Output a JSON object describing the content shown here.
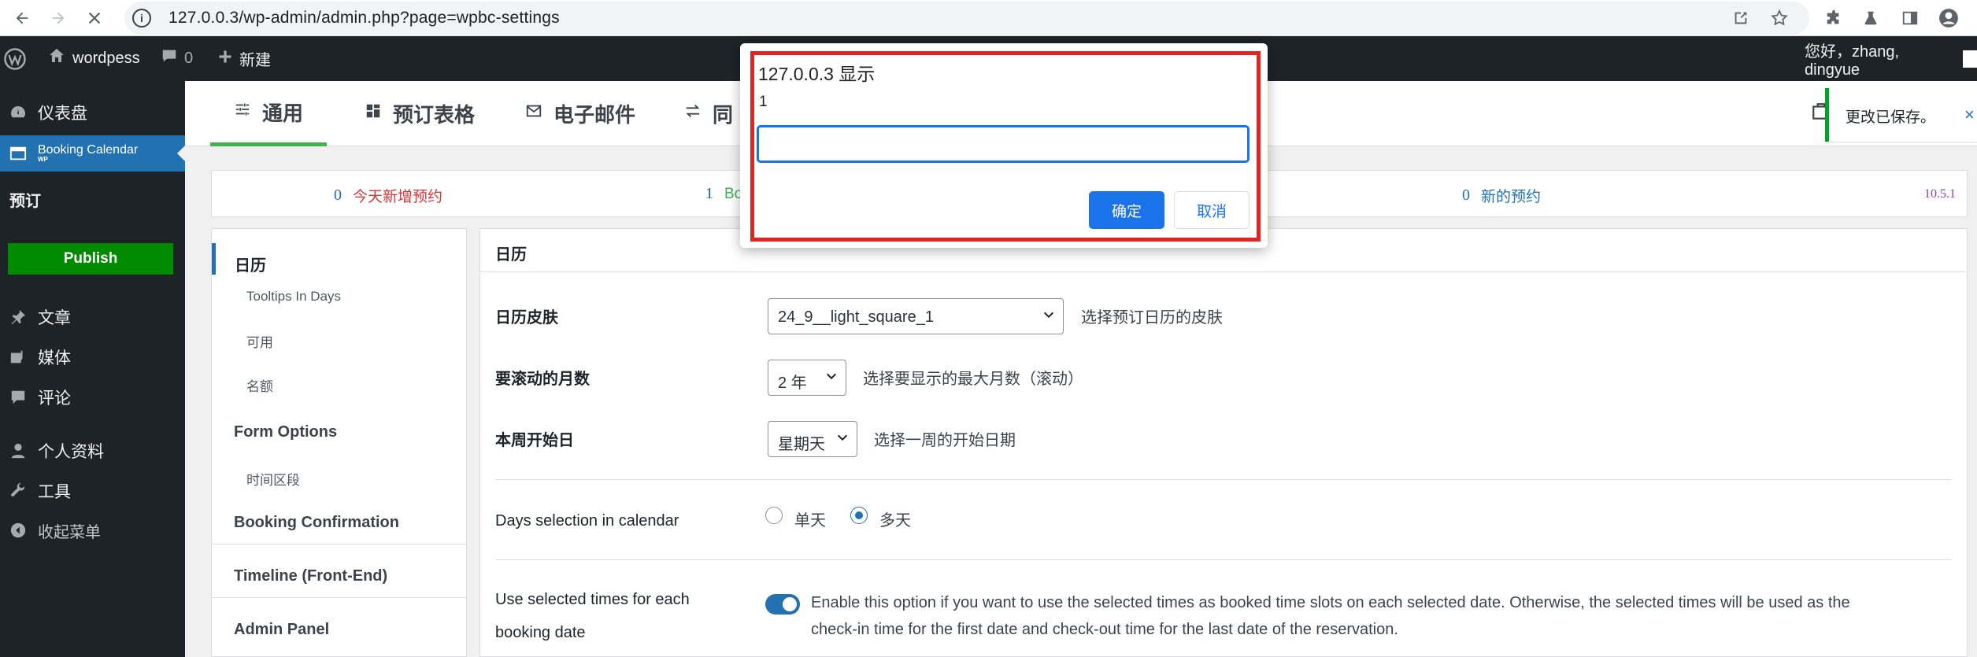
{
  "browser": {
    "url": "127.0.0.3/wp-admin/admin.php?page=wpbc-settings",
    "back_icon": "back-arrow-icon",
    "forward_icon": "forward-arrow-icon",
    "loading_icon": "stop-loading-icon"
  },
  "adminbar": {
    "site_name": "wordpess",
    "comments_count": "0",
    "new_label": "新建",
    "greeting": "您好，zhang, dingyue"
  },
  "sidebar": {
    "items": [
      {
        "label": "仪表盘",
        "icon": "dashboard-icon"
      },
      {
        "label": "Booking Calendar",
        "sub": "WP",
        "icon": "booking-calendar-icon"
      },
      {
        "label": "预订"
      },
      {
        "label": "文章",
        "icon": "pin-icon"
      },
      {
        "label": "媒体",
        "icon": "media-icon"
      },
      {
        "label": "评论",
        "icon": "comment-icon"
      },
      {
        "label": "个人资料",
        "icon": "user-icon"
      },
      {
        "label": "工具",
        "icon": "wrench-icon"
      },
      {
        "label": "收起菜单",
        "icon": "collapse-icon"
      }
    ],
    "publish_label": "Publish"
  },
  "tabs": [
    {
      "label": "通用",
      "icon": "sliders-icon",
      "active": true
    },
    {
      "label": "预订表格",
      "icon": "grid-icon"
    },
    {
      "label": "电子邮件",
      "icon": "envelope-icon"
    },
    {
      "label": "同",
      "icon": "sync-icon"
    }
  ],
  "notice": {
    "text": "更改已保存。",
    "close": "×"
  },
  "stats": {
    "today_count": "0",
    "today_label": "今天新增预约",
    "booking_count": "1",
    "booking_label": "Bo",
    "new_count": "0",
    "new_label": "新的预约",
    "version": "10.5.1"
  },
  "leftnav": [
    {
      "label": "日历",
      "type": "main",
      "active": true
    },
    {
      "label": "Tooltips In Days",
      "type": "sub"
    },
    {
      "label": "可用",
      "type": "sub"
    },
    {
      "label": "名额",
      "type": "sub"
    },
    {
      "label": "Form Options",
      "type": "main"
    },
    {
      "label": "时间区段",
      "type": "sub"
    },
    {
      "label": "Booking Confirmation",
      "type": "main"
    },
    {
      "label": "Timeline (Front-End)",
      "type": "main"
    },
    {
      "label": "Admin Panel",
      "type": "main"
    }
  ],
  "panel": {
    "title": "日历",
    "skin": {
      "label": "日历皮肤",
      "value": "24_9__light_square_1",
      "desc": "选择预订日历的皮肤"
    },
    "months": {
      "label": "要滚动的月数",
      "value": "2 年",
      "desc": "选择要显示的最大月数（滚动）"
    },
    "week_start": {
      "label": "本周开始日",
      "value": "星期天",
      "desc": "选择一周的开始日期"
    },
    "days_selection": {
      "label": "Days selection in calendar",
      "option_single": "单天",
      "option_multiple": "多天",
      "selected": "多天"
    },
    "selected_times": {
      "label_line1": "Use selected times for each",
      "label_line2": "booking date",
      "enabled": true,
      "desc_line1": "Enable this option if you want to use the selected times as booked time slots on each selected date. Otherwise, the selected times will be used as the",
      "desc_line2": "check-in time for the first date and check-out time for the last date of the reservation."
    }
  },
  "dialog": {
    "title": "127.0.0.3 显示",
    "message": "1",
    "input_value": "",
    "ok_label": "确定",
    "cancel_label": "取消"
  },
  "colors": {
    "accent": "#2271b1",
    "admin_dark": "#1d2327",
    "publish_green": "#008a00",
    "tab_active": "#3fb14d",
    "dialog_outline": "#e32222",
    "dialog_button": "#1a73e8",
    "today_label": "#d63638",
    "version": "#8c3fb2"
  }
}
